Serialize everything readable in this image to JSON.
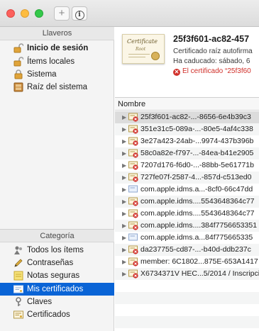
{
  "window": {
    "toolbar": {
      "add_label": "+",
      "info_label": "i"
    }
  },
  "sidebar": {
    "keychains_header": "Llaveros",
    "keychains": [
      {
        "label": "Inicio de sesión",
        "icon": "unlocked-padlock-icon",
        "bold": true
      },
      {
        "label": "Ítems locales",
        "icon": "unlocked-padlock-icon"
      },
      {
        "label": "Sistema",
        "icon": "locked-padlock-icon"
      },
      {
        "label": "Raíz del sistema",
        "icon": "cabinet-icon"
      }
    ],
    "category_header": "Categoría",
    "categories": [
      {
        "label": "Todos los ítems",
        "icon": "people-icon"
      },
      {
        "label": "Contraseñas",
        "icon": "pencil-icon"
      },
      {
        "label": "Notas seguras",
        "icon": "note-icon"
      },
      {
        "label": "Mis certificados",
        "icon": "certificate-icon",
        "selected": true
      },
      {
        "label": "Claves",
        "icon": "key-icon"
      },
      {
        "label": "Certificados",
        "icon": "certificate-icon"
      }
    ]
  },
  "detail": {
    "title": "25f3f601-ac82-457",
    "subtitle": "Certificado raíz autofirma",
    "expired": "Ha caducado: sábado, 6",
    "warning": "El certificado “25f3f60"
  },
  "table": {
    "column_header": "Nombre",
    "rows": [
      {
        "name": "25f3f601-ac82-...-8656-6e4b39c3",
        "icon": "certificate-error-icon"
      },
      {
        "name": "351e31c5-089a-...-80e5-4af4c338",
        "icon": "certificate-error-icon"
      },
      {
        "name": "3e27a423-24ab-...9974-437b396b",
        "icon": "certificate-error-icon"
      },
      {
        "name": "58c0a82e-f797-...-84ea-b41e2905",
        "icon": "certificate-error-icon"
      },
      {
        "name": "7207d176-f6d0-...-88bb-5e61771b",
        "icon": "certificate-error-icon"
      },
      {
        "name": "727fe07f-2587-4...-857d-c513ed0",
        "icon": "certificate-error-icon"
      },
      {
        "name": "com.apple.idms.a...-8cf0-66c47dd",
        "icon": "certificate-icon"
      },
      {
        "name": "com.apple.idms....5543648364c77",
        "icon": "certificate-error-icon"
      },
      {
        "name": "com.apple.idms....5543648364c77",
        "icon": "certificate-error-icon"
      },
      {
        "name": "com.apple.idms....384f7756653351",
        "icon": "certificate-error-icon"
      },
      {
        "name": "com.apple.idms.a...84f775665335",
        "icon": "certificate-icon"
      },
      {
        "name": "da237755-cd87-...-b40d-ddb237c",
        "icon": "certificate-error-icon"
      },
      {
        "name": "member: 6C1802...875E-653A1417",
        "icon": "certificate-error-icon"
      },
      {
        "name": "X6734371V HEC...5/2014 / Inscripci",
        "icon": "certificate-error-icon"
      }
    ]
  },
  "colors": {
    "selection": "#0a64d6",
    "error": "#d0302a"
  }
}
